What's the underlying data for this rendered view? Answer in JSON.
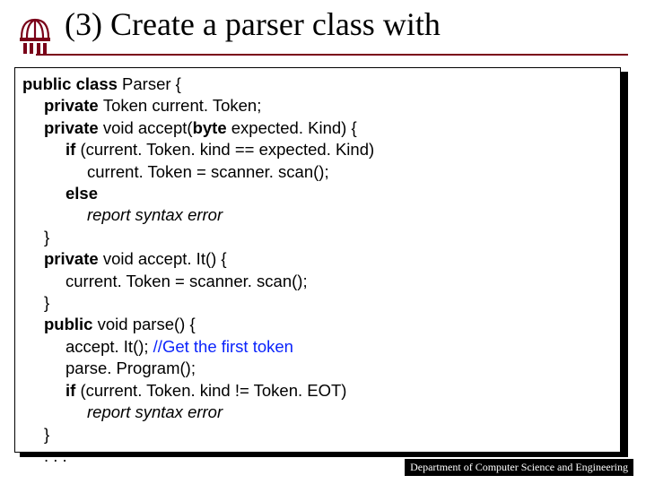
{
  "title": "(3)  Create a parser class with",
  "footer": "Department of Computer Science and Engineering",
  "code": {
    "l1_pre": "public class ",
    "l1_post": "Parser {",
    "l2_pre": "private ",
    "l2_post": "Token current. Token;",
    "l3_pre": "private ",
    "l3_mid": "void accept(",
    "l3_byte": "byte",
    "l3_post": " expected. Kind) {",
    "l4_pre": "if ",
    "l4_post": "(current. Token. kind == expected. Kind)",
    "l5": "current. Token = scanner. scan();",
    "l6": "else",
    "l7": "report syntax error",
    "l8": "}",
    "l9_pre": "private ",
    "l9_post": "void accept. It() {",
    "l10": "current. Token = scanner. scan();",
    "l11": "}",
    "l12_pre": "public ",
    "l12_post": "void parse() {",
    "l13_a": "accept. It(); ",
    "l13_b": "//Get the first token",
    "l14": "parse. Program();",
    "l15_pre": "if ",
    "l15_post": "(current. Token. kind != Token. EOT)",
    "l16": "report syntax error",
    "l17": "}",
    "l18": ". . ."
  }
}
